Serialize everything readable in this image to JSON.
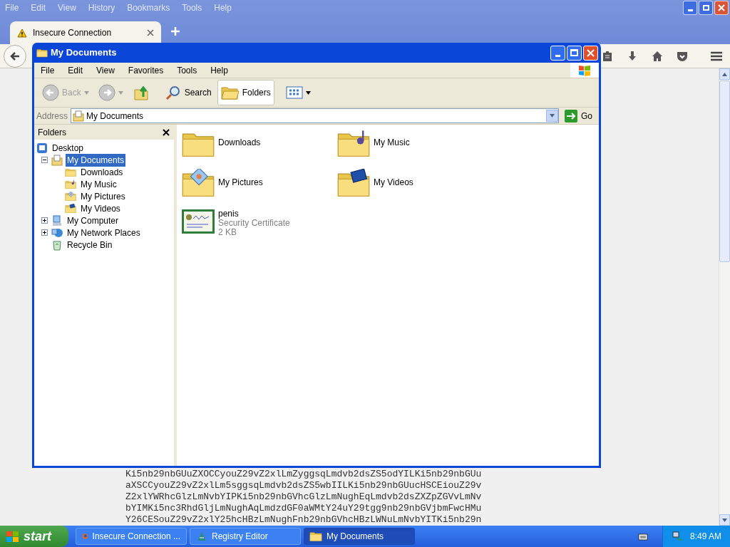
{
  "browser": {
    "menu": [
      "File",
      "Edit",
      "View",
      "History",
      "Bookmarks",
      "Tools",
      "Help"
    ],
    "tabs": [
      {
        "title": "Insecure Connection",
        "selected": true
      }
    ],
    "page_text": [
      "Ki5nb29nbGUuZXOCCyouZ29vZ2xlLmZyggsqLmdvb2dsZS5odYILKi5nb29nbGUu",
      "aXSCCyouZ29vZ2xlLm5sggsqLmdvb2dsZS5wbIILKi5nb29nbGUucHSCEiouZ29v",
      "Z2xlYWRhcGlzLmNvbYIPKi5nb29nbGVhcGlzLmNughEqLmdvb2dsZXZpZGVvLmNv",
      "bYIMKi5nc3RhdGljLmNughAqLmdzdGF0aWMtY24uY29tgg9nb29nbGVjbmFwcHMu",
      "Y26CESouZ29vZ2xlY25hcHBzLmNughFnb29nbGVhcHBzLWNuLmNvbYITKi5nb29n"
    ]
  },
  "explorer": {
    "title": "My Documents",
    "menu": [
      "File",
      "Edit",
      "View",
      "Favorites",
      "Tools",
      "Help"
    ],
    "toolbar": [
      {
        "kind": "back",
        "label": "Back",
        "disabled": true
      },
      {
        "kind": "forward",
        "disabled": true
      },
      {
        "kind": "up"
      },
      {
        "kind": "search",
        "label": "Search",
        "selected": false
      },
      {
        "kind": "folders",
        "label": "Folders",
        "selected": true
      },
      {
        "kind": "views"
      }
    ],
    "address": {
      "label": "Address",
      "value": "My Documents",
      "go": "Go"
    },
    "folders_pane": {
      "title": "Folders",
      "tree": [
        {
          "label": "Desktop",
          "kind": "desktop",
          "selected": false,
          "children": [
            {
              "label": "My Documents",
              "kind": "documents",
              "selected": true,
              "expanded": true,
              "children": [
                {
                  "label": "Downloads",
                  "kind": "folder",
                  "selected": false
                },
                {
                  "label": "My Music",
                  "kind": "music",
                  "selected": false
                },
                {
                  "label": "My Pictures",
                  "kind": "pictures",
                  "selected": false
                },
                {
                  "label": "My Videos",
                  "kind": "videos",
                  "selected": false
                }
              ]
            },
            {
              "label": "My Computer",
              "kind": "computer",
              "selected": false,
              "expanded": false
            },
            {
              "label": "My Network Places",
              "kind": "network",
              "selected": false,
              "expanded": false
            },
            {
              "label": "Recycle Bin",
              "kind": "recycle",
              "selected": false
            }
          ]
        }
      ]
    },
    "items": [
      {
        "name": "Downloads",
        "kind": "folder"
      },
      {
        "name": "My Music",
        "kind": "music"
      },
      {
        "name": "My Pictures",
        "kind": "pictures"
      },
      {
        "name": "My Videos",
        "kind": "videos"
      },
      {
        "name": "penis",
        "kind": "certificate",
        "details": [
          "Security Certificate",
          "2 KB"
        ]
      }
    ]
  },
  "taskbar": {
    "start": "start",
    "tasks": [
      {
        "label": "Insecure Connection ...",
        "kind": "firefox",
        "selected": false
      },
      {
        "label": "Registry Editor",
        "kind": "registry",
        "selected": false
      },
      {
        "label": "My Documents",
        "kind": "folder",
        "selected": true
      }
    ],
    "clock": "8:49 AM"
  }
}
